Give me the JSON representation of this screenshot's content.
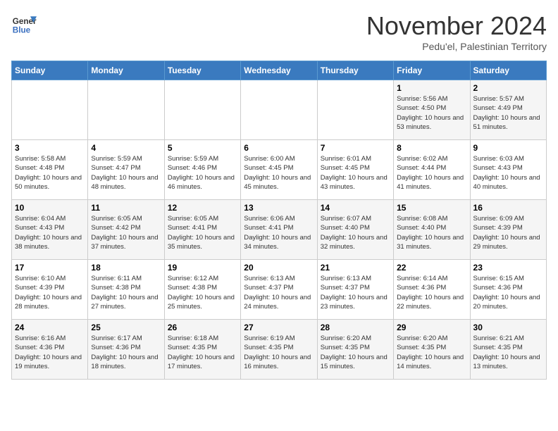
{
  "logo": {
    "line1": "General",
    "line2": "Blue"
  },
  "title": "November 2024",
  "subtitle": "Pedu'el, Palestinian Territory",
  "days_header": [
    "Sunday",
    "Monday",
    "Tuesday",
    "Wednesday",
    "Thursday",
    "Friday",
    "Saturday"
  ],
  "weeks": [
    [
      {
        "day": "",
        "info": ""
      },
      {
        "day": "",
        "info": ""
      },
      {
        "day": "",
        "info": ""
      },
      {
        "day": "",
        "info": ""
      },
      {
        "day": "",
        "info": ""
      },
      {
        "day": "1",
        "info": "Sunrise: 5:56 AM\nSunset: 4:50 PM\nDaylight: 10 hours and 53 minutes."
      },
      {
        "day": "2",
        "info": "Sunrise: 5:57 AM\nSunset: 4:49 PM\nDaylight: 10 hours and 51 minutes."
      }
    ],
    [
      {
        "day": "3",
        "info": "Sunrise: 5:58 AM\nSunset: 4:48 PM\nDaylight: 10 hours and 50 minutes."
      },
      {
        "day": "4",
        "info": "Sunrise: 5:59 AM\nSunset: 4:47 PM\nDaylight: 10 hours and 48 minutes."
      },
      {
        "day": "5",
        "info": "Sunrise: 5:59 AM\nSunset: 4:46 PM\nDaylight: 10 hours and 46 minutes."
      },
      {
        "day": "6",
        "info": "Sunrise: 6:00 AM\nSunset: 4:45 PM\nDaylight: 10 hours and 45 minutes."
      },
      {
        "day": "7",
        "info": "Sunrise: 6:01 AM\nSunset: 4:45 PM\nDaylight: 10 hours and 43 minutes."
      },
      {
        "day": "8",
        "info": "Sunrise: 6:02 AM\nSunset: 4:44 PM\nDaylight: 10 hours and 41 minutes."
      },
      {
        "day": "9",
        "info": "Sunrise: 6:03 AM\nSunset: 4:43 PM\nDaylight: 10 hours and 40 minutes."
      }
    ],
    [
      {
        "day": "10",
        "info": "Sunrise: 6:04 AM\nSunset: 4:43 PM\nDaylight: 10 hours and 38 minutes."
      },
      {
        "day": "11",
        "info": "Sunrise: 6:05 AM\nSunset: 4:42 PM\nDaylight: 10 hours and 37 minutes."
      },
      {
        "day": "12",
        "info": "Sunrise: 6:05 AM\nSunset: 4:41 PM\nDaylight: 10 hours and 35 minutes."
      },
      {
        "day": "13",
        "info": "Sunrise: 6:06 AM\nSunset: 4:41 PM\nDaylight: 10 hours and 34 minutes."
      },
      {
        "day": "14",
        "info": "Sunrise: 6:07 AM\nSunset: 4:40 PM\nDaylight: 10 hours and 32 minutes."
      },
      {
        "day": "15",
        "info": "Sunrise: 6:08 AM\nSunset: 4:40 PM\nDaylight: 10 hours and 31 minutes."
      },
      {
        "day": "16",
        "info": "Sunrise: 6:09 AM\nSunset: 4:39 PM\nDaylight: 10 hours and 29 minutes."
      }
    ],
    [
      {
        "day": "17",
        "info": "Sunrise: 6:10 AM\nSunset: 4:39 PM\nDaylight: 10 hours and 28 minutes."
      },
      {
        "day": "18",
        "info": "Sunrise: 6:11 AM\nSunset: 4:38 PM\nDaylight: 10 hours and 27 minutes."
      },
      {
        "day": "19",
        "info": "Sunrise: 6:12 AM\nSunset: 4:38 PM\nDaylight: 10 hours and 25 minutes."
      },
      {
        "day": "20",
        "info": "Sunrise: 6:13 AM\nSunset: 4:37 PM\nDaylight: 10 hours and 24 minutes."
      },
      {
        "day": "21",
        "info": "Sunrise: 6:13 AM\nSunset: 4:37 PM\nDaylight: 10 hours and 23 minutes."
      },
      {
        "day": "22",
        "info": "Sunrise: 6:14 AM\nSunset: 4:36 PM\nDaylight: 10 hours and 22 minutes."
      },
      {
        "day": "23",
        "info": "Sunrise: 6:15 AM\nSunset: 4:36 PM\nDaylight: 10 hours and 20 minutes."
      }
    ],
    [
      {
        "day": "24",
        "info": "Sunrise: 6:16 AM\nSunset: 4:36 PM\nDaylight: 10 hours and 19 minutes."
      },
      {
        "day": "25",
        "info": "Sunrise: 6:17 AM\nSunset: 4:36 PM\nDaylight: 10 hours and 18 minutes."
      },
      {
        "day": "26",
        "info": "Sunrise: 6:18 AM\nSunset: 4:35 PM\nDaylight: 10 hours and 17 minutes."
      },
      {
        "day": "27",
        "info": "Sunrise: 6:19 AM\nSunset: 4:35 PM\nDaylight: 10 hours and 16 minutes."
      },
      {
        "day": "28",
        "info": "Sunrise: 6:20 AM\nSunset: 4:35 PM\nDaylight: 10 hours and 15 minutes."
      },
      {
        "day": "29",
        "info": "Sunrise: 6:20 AM\nSunset: 4:35 PM\nDaylight: 10 hours and 14 minutes."
      },
      {
        "day": "30",
        "info": "Sunrise: 6:21 AM\nSunset: 4:35 PM\nDaylight: 10 hours and 13 minutes."
      }
    ]
  ]
}
